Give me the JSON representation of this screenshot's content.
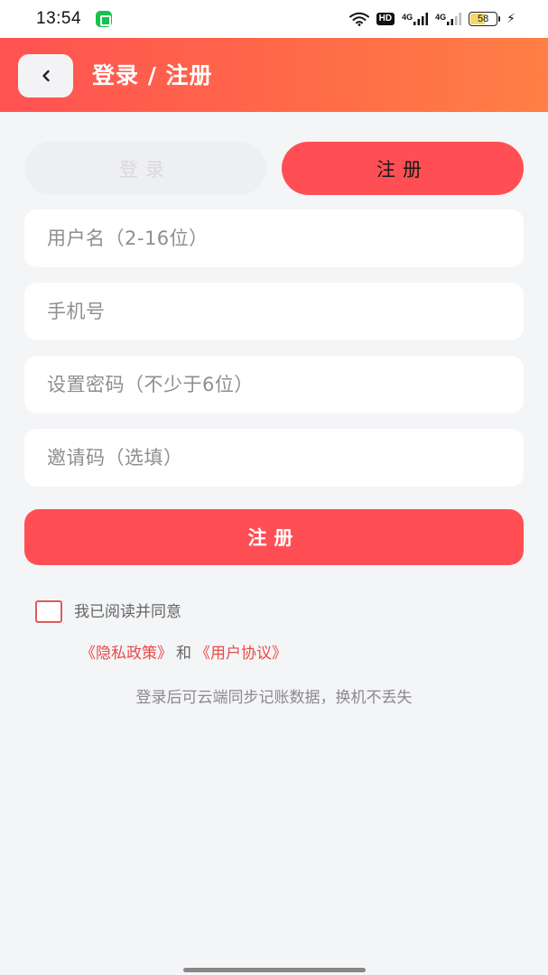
{
  "status_bar": {
    "time": "13:54",
    "hd_badge": "HD",
    "signal_1_label": "4G",
    "signal_2_label": "4G",
    "battery_level": "58",
    "battery_percent": 58,
    "icons": [
      "app-notification-icon",
      "wifi-icon",
      "signal-icon",
      "signal-icon",
      "battery-icon",
      "charging-bolt-icon"
    ]
  },
  "header": {
    "back_icon": "‹",
    "title": "登录 / 注册"
  },
  "tabs": [
    {
      "label": "登录",
      "active": false
    },
    {
      "label": "注册",
      "active": true
    }
  ],
  "form": {
    "username_placeholder": "用户名（2-16位）",
    "phone_placeholder": "手机号",
    "password_placeholder": "设置密码（不少于6位）",
    "invite_placeholder": "邀请码（选填）",
    "username_value": "",
    "phone_value": "",
    "password_value": "",
    "invite_value": ""
  },
  "submit_label": "注册",
  "agreement": {
    "checked": false,
    "text": "我已阅读并同意",
    "privacy_link": "《隐私政策》",
    "and_text": "和",
    "user_agreement_link": "《用户协议》"
  },
  "hint": "登录后可云端同步记账数据，换机不丢失",
  "colors": {
    "accent": "#ff4f54",
    "header_gradient_start": "#ff5252",
    "header_gradient_end": "#ff7f45",
    "link": "#e84b4b",
    "background": "#f4f5f7"
  }
}
